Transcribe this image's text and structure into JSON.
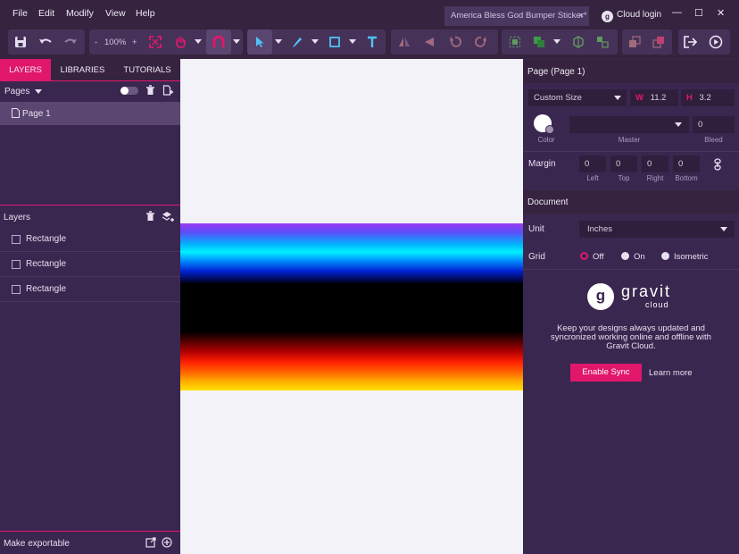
{
  "menu": [
    "File",
    "Edit",
    "Modify",
    "View",
    "Help"
  ],
  "document_tab": {
    "title": "America Bless God Bumper Sticker*",
    "close": "×"
  },
  "cloud_login": {
    "badge": "g",
    "label": "Cloud login"
  },
  "window_controls": {
    "minimize": "—",
    "maximize": "☐",
    "close": "✕"
  },
  "toolbar": {
    "zoom_minus": "-",
    "zoom_value": "100%",
    "zoom_plus": "+"
  },
  "left_panel": {
    "tabs": [
      "LAYERS",
      "LIBRARIES",
      "TUTORIALS"
    ],
    "pages_label": "Pages",
    "pages": [
      "Page 1"
    ],
    "layers_label": "Layers",
    "layers": [
      "Rectangle",
      "Rectangle",
      "Rectangle"
    ],
    "export_label": "Make exportable"
  },
  "right_panel": {
    "page_title": "Page (Page 1)",
    "size_preset": "Custom Size",
    "width_label": "W",
    "width": "11.2",
    "height_label": "H",
    "height": "3.2",
    "color_label": "Color",
    "master_label": "Master",
    "bleed_label": "Bleed",
    "bleed": "0",
    "margin_label": "Margin",
    "margins": [
      {
        "label": "Left",
        "value": "0"
      },
      {
        "label": "Top",
        "value": "0"
      },
      {
        "label": "Right",
        "value": "0"
      },
      {
        "label": "Bottom",
        "value": "0"
      }
    ],
    "document_title": "Document",
    "unit_label": "Unit",
    "unit": "Inches",
    "grid_label": "Grid",
    "grid_options": [
      "Off",
      "On",
      "Isometric"
    ],
    "grid_selected": "Off",
    "gravit_logo": "g",
    "gravit_name": "gravit",
    "gravit_sub": "cloud",
    "cloud_text": "Keep your designs always updated and syncronized working online and offline with Gravit Cloud.",
    "enable_sync": "Enable Sync",
    "learn_more": "Learn more"
  },
  "colors": {
    "accent": "#e0176b",
    "panel": "#3a2750",
    "canvas": "#f2f2f8"
  }
}
